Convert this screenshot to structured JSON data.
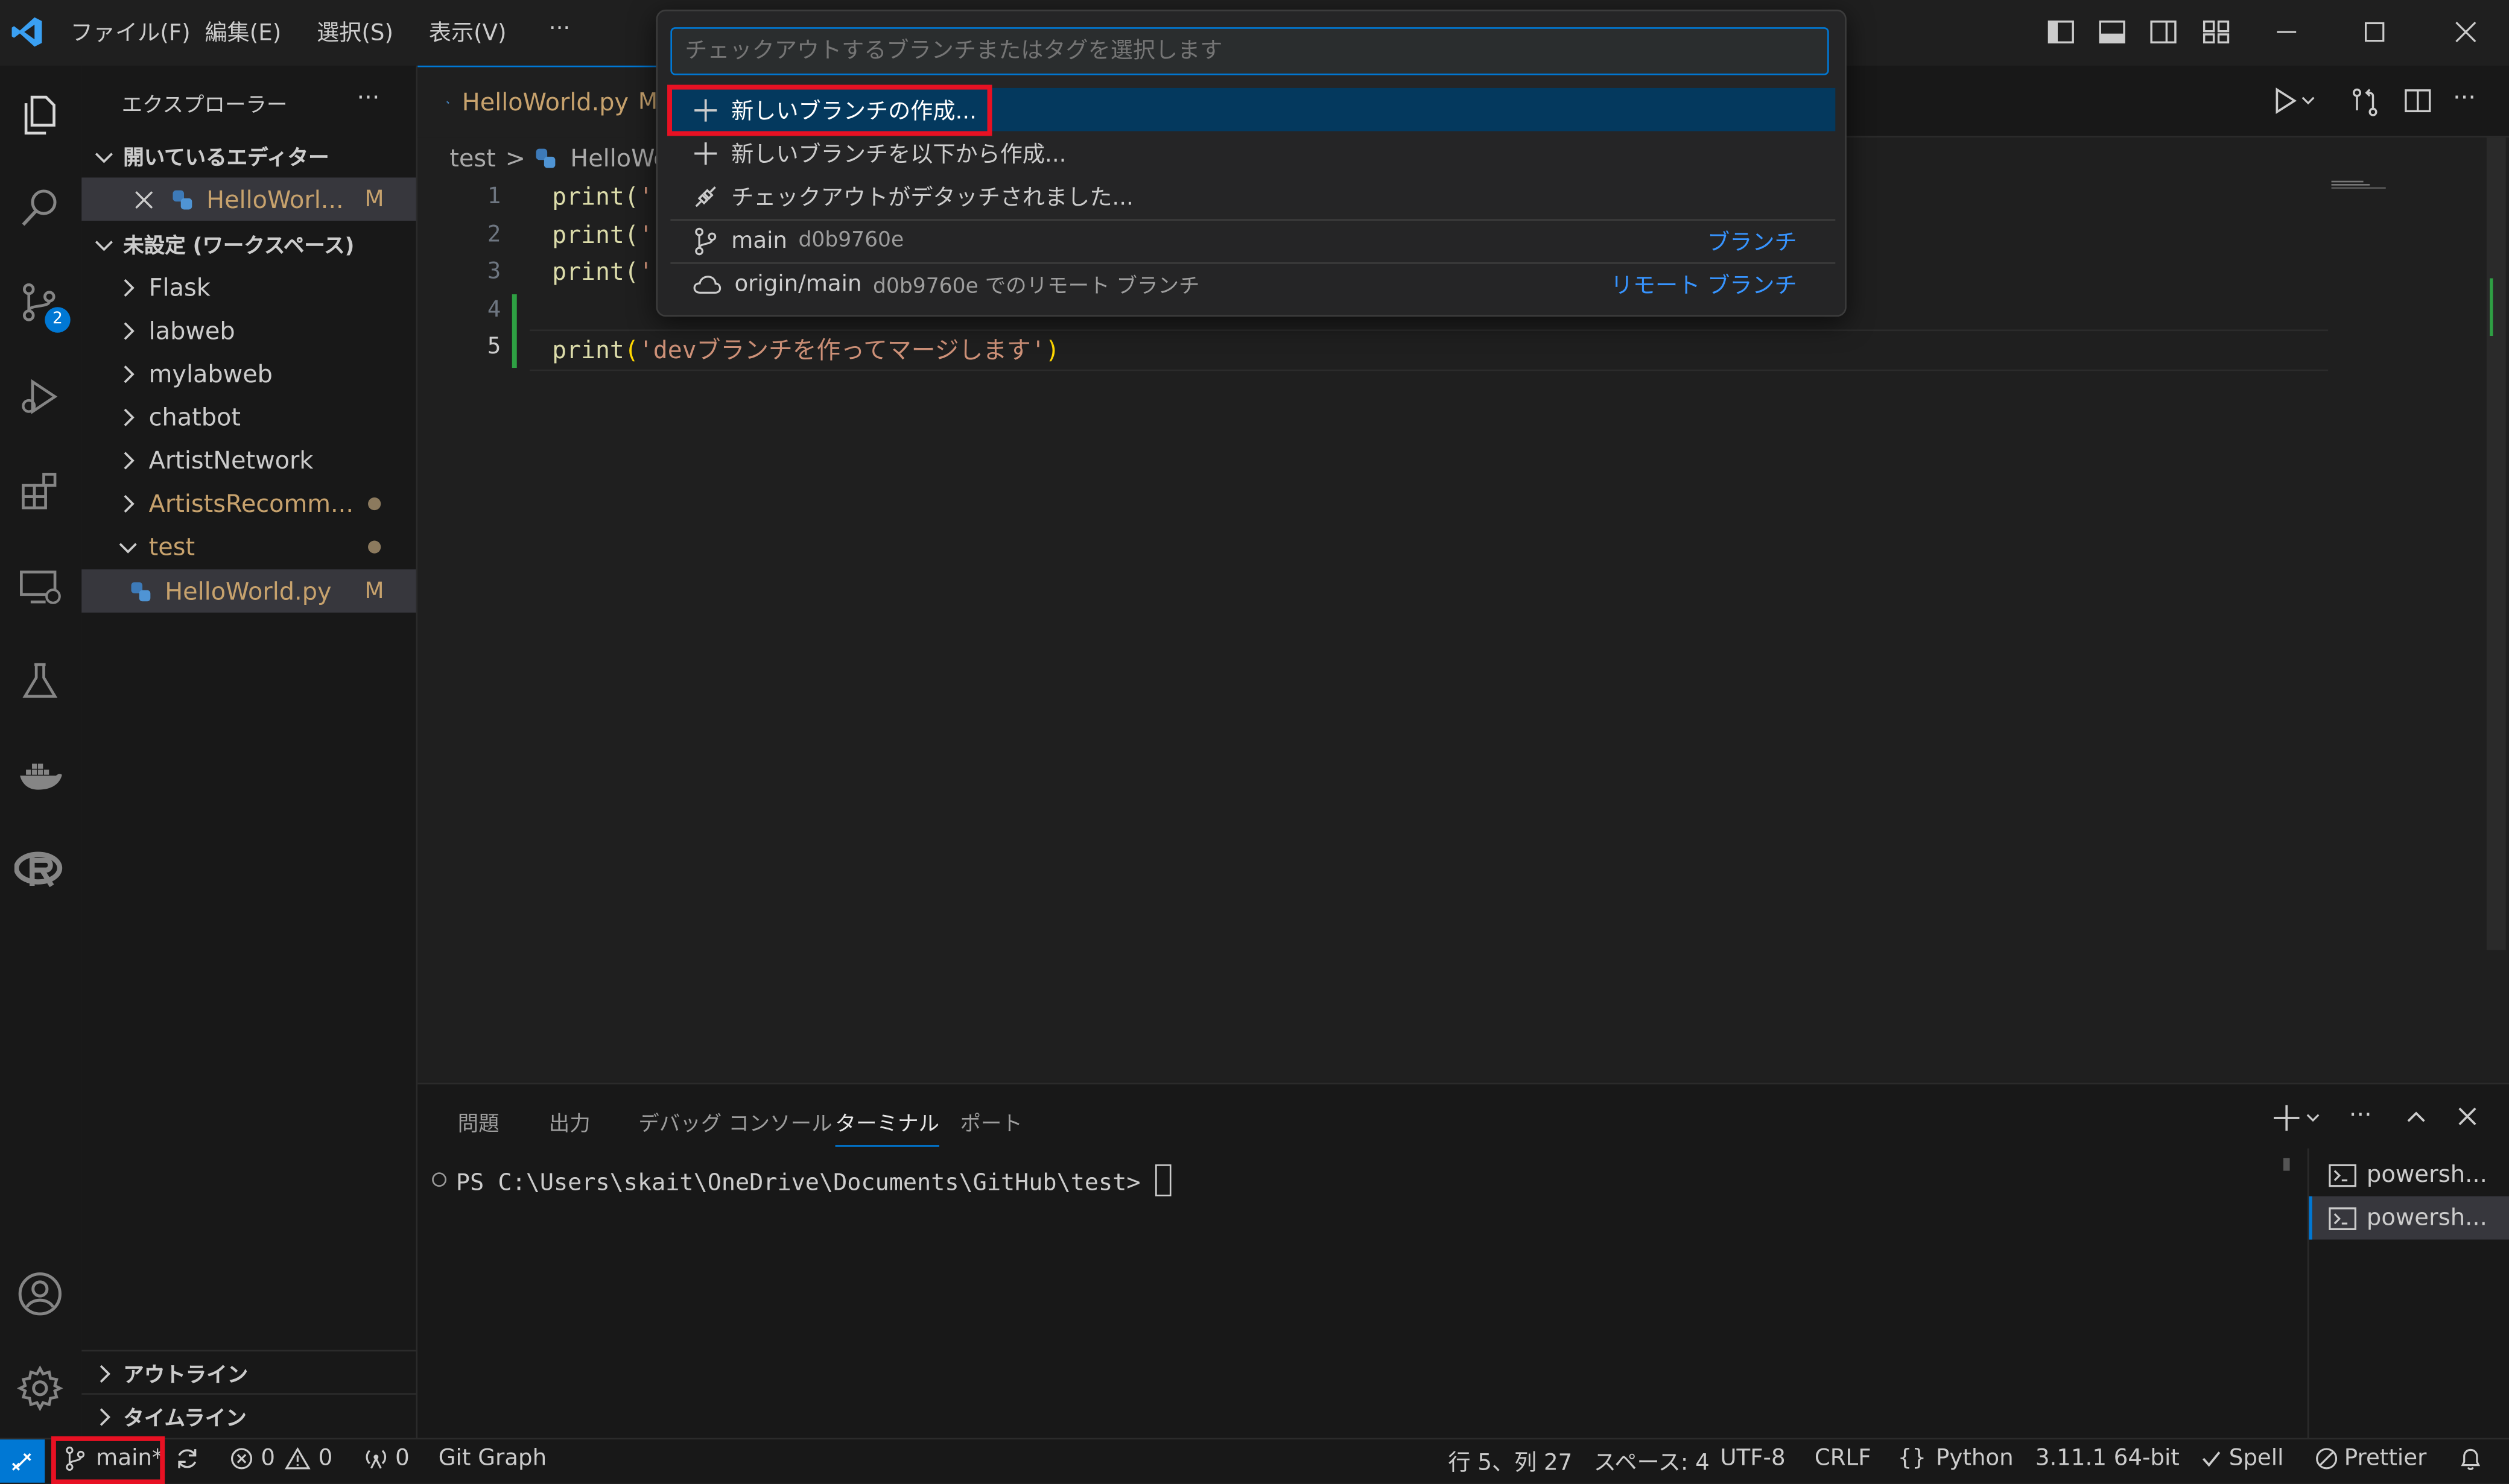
{
  "menu": [
    "ファイル(F)",
    "編集(E)",
    "選択(S)",
    "表示(V)",
    "···"
  ],
  "sidebar": {
    "title": "エクスプローラー",
    "more": "···",
    "open_editors_header": "開いているエディター",
    "open_editor_file": "HelloWorl...",
    "open_editor_mod": "M",
    "workspace_header": "未設定 (ワークスペース)",
    "folders": [
      "Flask",
      "labweb",
      "mylabweb",
      "chatbot",
      "ArtistNetwork",
      "ArtistsRecomm...",
      "test"
    ],
    "test_file": "HelloWorld.py",
    "test_file_mod": "M",
    "outline_header": "アウトライン",
    "timeline_header": "タイムライン"
  },
  "source_control_badge": "2",
  "editor": {
    "tab_label": "HelloWorld.py",
    "tab_suffix": "M",
    "breadcrumb_folder": "test",
    "breadcrumb_sep": ">",
    "breadcrumb_file": "HelloWo",
    "line_numbers": [
      "1",
      "2",
      "3",
      "4",
      "5"
    ],
    "line1_fn": "print(",
    "line1_str": "'",
    "line2_fn": "print(",
    "line2_str": "'",
    "line3_fn": "print(",
    "line3_str": "'",
    "line5_fn": "print",
    "line5_open": "(",
    "line5_str": "'devブランチを作ってマージします'",
    "line5_close": ")"
  },
  "quickpick": {
    "placeholder": "チェックアウトするブランチまたはタグを選択します",
    "items": [
      {
        "label": "新しいブランチの作成..."
      },
      {
        "label": "新しいブランチを以下から作成..."
      },
      {
        "label": "チェックアウトがデタッチされました..."
      },
      {
        "label": "main",
        "desc": "d0b9760e",
        "right": "ブランチ"
      },
      {
        "label": "origin/main",
        "desc": "d0b9760e でのリモート ブランチ",
        "right": "リモート ブランチ"
      }
    ]
  },
  "panel": {
    "tabs": [
      "問題",
      "出力",
      "デバッグ コンソール",
      "ターミナル",
      "ポート"
    ],
    "active_tab": "ターミナル",
    "prompt": "PS C:\\Users\\skait\\OneDrive\\Documents\\GitHub\\test>",
    "terminals": [
      "powersh...",
      "powersh..."
    ]
  },
  "status": {
    "branch": "main*",
    "errors": "0",
    "warnings": "0",
    "ports": "0",
    "git_graph": "Git Graph",
    "position": "行 5、列 27",
    "spaces": "スペース: 4",
    "encoding": "UTF-8",
    "eol": "CRLF",
    "language": "Python",
    "interpreter": "3.11.1 64-bit",
    "spell": "Spell",
    "prettier": "Prettier"
  },
  "colors": {
    "accent": "#0078d4",
    "selection": "#04395e",
    "highlight": "#e81123",
    "modified": "#c7a26d",
    "link": "#3794ff"
  }
}
